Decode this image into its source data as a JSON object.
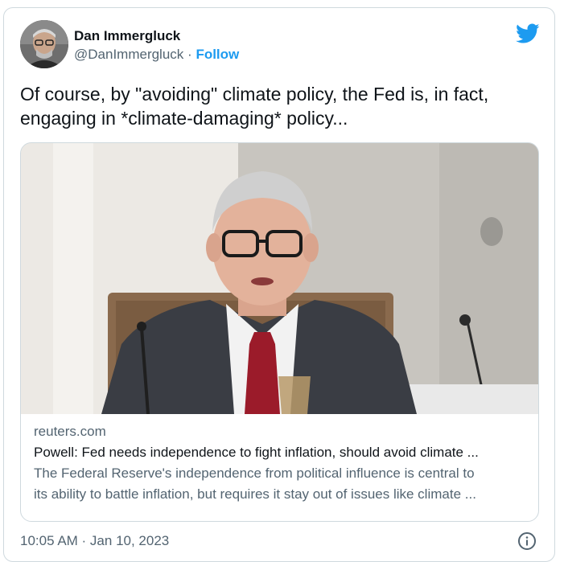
{
  "author": {
    "display_name": "Dan Immergluck",
    "handle": "@DanImmergluck",
    "separator": "·",
    "follow_label": "Follow",
    "avatar_icon": "avatar-photo"
  },
  "platform_icon": "twitter-bird-icon",
  "tweet_text": {
    "line1": "Of course, by \"avoiding\" climate policy, the Fed is, in fact,",
    "line2": "engaging in *climate-damaging* policy..."
  },
  "card": {
    "domain": "reuters.com",
    "title": "Powell: Fed needs independence to fight inflation, should avoid climate ...",
    "description_line1": "The Federal Reserve's independence from political influence is central to",
    "description_line2": "its ability to battle inflation, but requires it stay out of issues like climate ..."
  },
  "footer": {
    "timestamp": "10:05 AM · Jan 10, 2023",
    "info_icon": "info-icon"
  },
  "colors": {
    "accent": "#1d9bf0",
    "text_primary": "#0f1419",
    "text_secondary": "#536471",
    "border": "#cfd9de"
  }
}
